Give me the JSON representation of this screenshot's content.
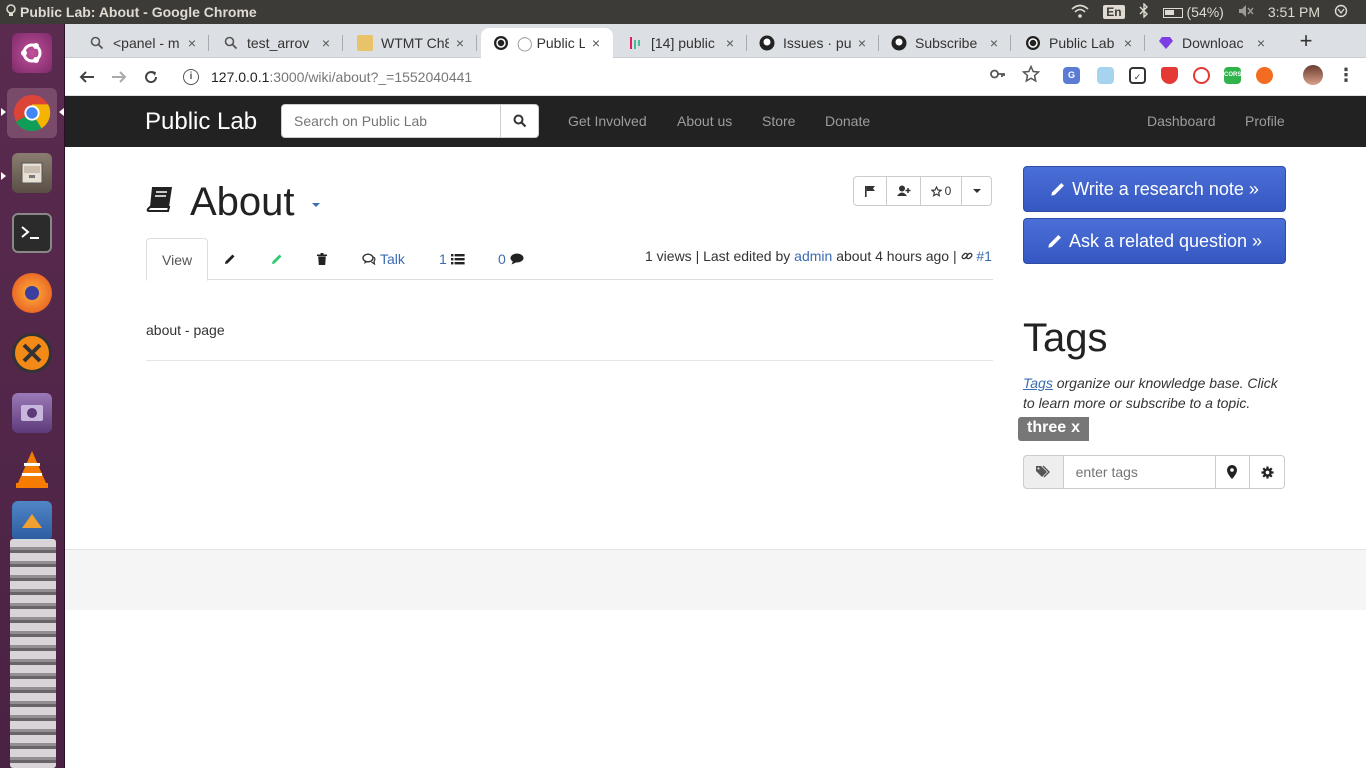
{
  "os": {
    "window_title": "Public Lab: About - Google Chrome",
    "keyboard": "En",
    "battery": "(54%)",
    "clock": "3:51 PM"
  },
  "browser": {
    "tabs": [
      {
        "label": "<panel - m",
        "icon": "search-icon"
      },
      {
        "label": "test_arrov",
        "icon": "search-icon"
      },
      {
        "label": "WTMT Ch8",
        "icon": "page-icon"
      },
      {
        "label": "Public L",
        "icon": "publiclab-icon",
        "active": true
      },
      {
        "label": "[14] public",
        "icon": "gitter-icon"
      },
      {
        "label": "Issues · pu",
        "icon": "github-icon"
      },
      {
        "label": "Subscribe",
        "icon": "github-icon"
      },
      {
        "label": "Public Lab",
        "icon": "publiclab-icon"
      },
      {
        "label": "Downloac",
        "icon": "diamond-icon"
      }
    ],
    "close_glyph": "×",
    "new_tab": "+",
    "url_host": "127.0.0.1",
    "url_path": ":3000/wiki/about?_=1552040441"
  },
  "navbar": {
    "brand": "Public Lab",
    "search_placeholder": "Search on Public Lab",
    "links": [
      "Get Involved",
      "About us",
      "Store",
      "Donate"
    ],
    "right_links": [
      "Dashboard",
      "Profile"
    ]
  },
  "wiki": {
    "title": "About",
    "star_count": "0",
    "tabs": {
      "view": "View",
      "talk": "Talk",
      "revisions": "1",
      "comments": "0"
    },
    "meta": {
      "views": "1 views | Last edited by",
      "author": "admin",
      "when": "about 4 hours ago |",
      "rev": "#1"
    },
    "body": "about - page"
  },
  "sidebar": {
    "write_note": "Write a research note »",
    "ask_question": "Ask a related question »",
    "tags_heading": "Tags",
    "tags_link": "Tags",
    "tags_desc": "organize our knowledge base. Click to learn more or subscribe to a topic.",
    "tag": "three",
    "tag_remove": "x",
    "tag_input_placeholder": "enter tags"
  }
}
